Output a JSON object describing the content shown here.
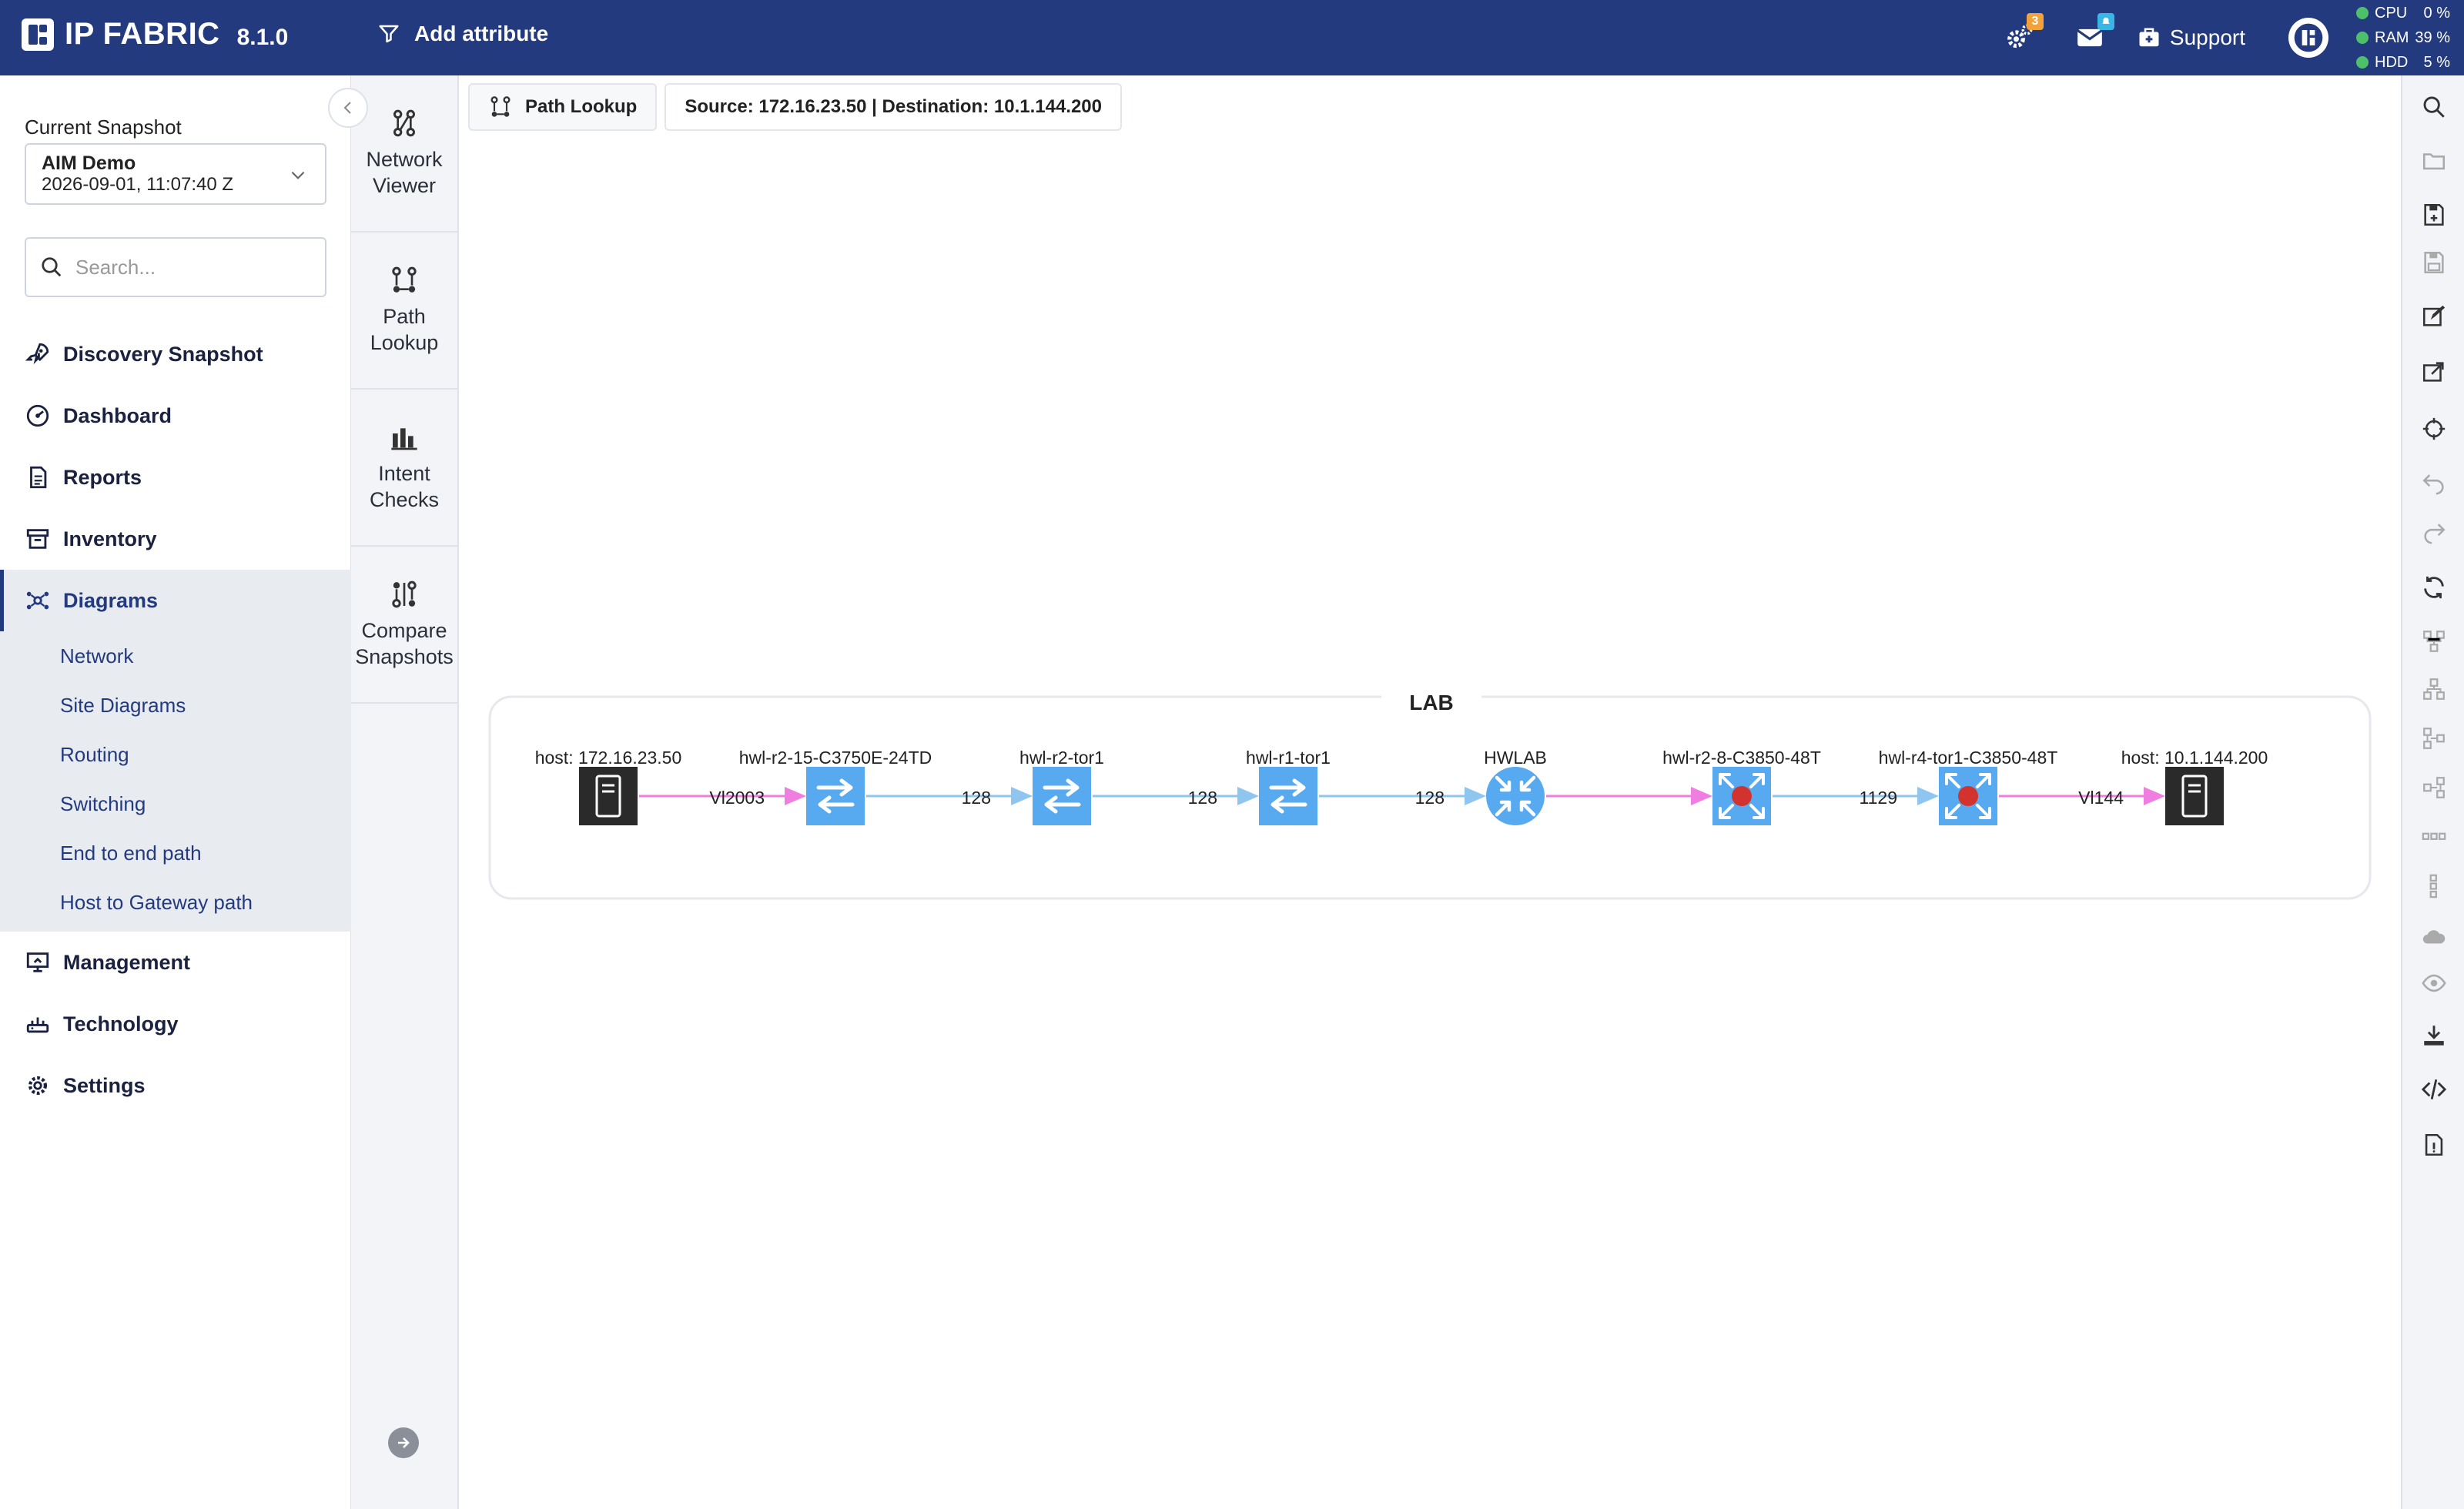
{
  "app": {
    "name": "IP FABRIC",
    "version": "8.1.0"
  },
  "topbar": {
    "add_attribute_label": "Add attribute",
    "settings_badge": "3",
    "messages_badge": "",
    "support_label": "Support",
    "stats": [
      {
        "name": "CPU",
        "value": "0 %"
      },
      {
        "name": "RAM",
        "value": "39 %"
      },
      {
        "name": "HDD",
        "value": "5 %"
      }
    ]
  },
  "sidebar": {
    "snapshot_label": "Current Snapshot",
    "snapshot_name": "AIM Demo",
    "snapshot_date": "2026-09-01, 11:07:40 Z",
    "search_placeholder": "Search...",
    "nav": [
      {
        "label": "Discovery Snapshot",
        "icon": "rocket-icon"
      },
      {
        "label": "Dashboard",
        "icon": "dashboard-icon"
      },
      {
        "label": "Reports",
        "icon": "report-icon"
      },
      {
        "label": "Inventory",
        "icon": "archive-icon"
      },
      {
        "label": "Diagrams",
        "icon": "diagram-icon"
      },
      {
        "label": "Management",
        "icon": "monitor-icon"
      },
      {
        "label": "Technology",
        "icon": "router-icon"
      },
      {
        "label": "Settings",
        "icon": "gear-icon"
      }
    ],
    "diagrams_sub": [
      "Network",
      "Site Diagrams",
      "Routing",
      "Switching",
      "End to end path",
      "Host to Gateway path"
    ]
  },
  "toolstrip": {
    "tools": [
      {
        "line1": "Network",
        "line2": "Viewer"
      },
      {
        "line1": "Path",
        "line2": "Lookup"
      },
      {
        "line1": "Intent",
        "line2": "Checks"
      },
      {
        "line1": "Compare",
        "line2": "Snapshots"
      }
    ]
  },
  "main": {
    "tab_label": "Path Lookup",
    "path_info": "Source: 172.16.23.50 | Destination: 10.1.144.200"
  },
  "diagram": {
    "group_label": "LAB",
    "nodes": [
      {
        "label": "host: 172.16.23.50",
        "type": "host"
      },
      {
        "label": "hwl-r2-15-C3750E-24TD",
        "type": "switch"
      },
      {
        "label": "hwl-r2-tor1",
        "type": "switch"
      },
      {
        "label": "hwl-r1-tor1",
        "type": "switch"
      },
      {
        "label": "HWLAB",
        "type": "router"
      },
      {
        "label": "hwl-r2-8-C3850-48T",
        "type": "l3switch"
      },
      {
        "label": "hwl-r4-tor1-C3850-48T",
        "type": "l3switch"
      },
      {
        "label": "host: 10.1.144.200",
        "type": "host"
      }
    ],
    "links": [
      {
        "label": "Vl2003",
        "color": "#f07de0"
      },
      {
        "label": "128",
        "color": "#8ec6f0"
      },
      {
        "label": "128",
        "color": "#8ec6f0"
      },
      {
        "label": "128",
        "color": "#8ec6f0"
      },
      {
        "label": "",
        "color": "#f07de0"
      },
      {
        "label": "1129",
        "color": "#8ec6f0"
      },
      {
        "label": "Vl144",
        "color": "#f07de0"
      }
    ]
  },
  "colors": {
    "brand": "#233a7e",
    "device_blue": "#58aaf0",
    "host_dark": "#2a2a2a",
    "l3_dot": "#d2332e"
  }
}
